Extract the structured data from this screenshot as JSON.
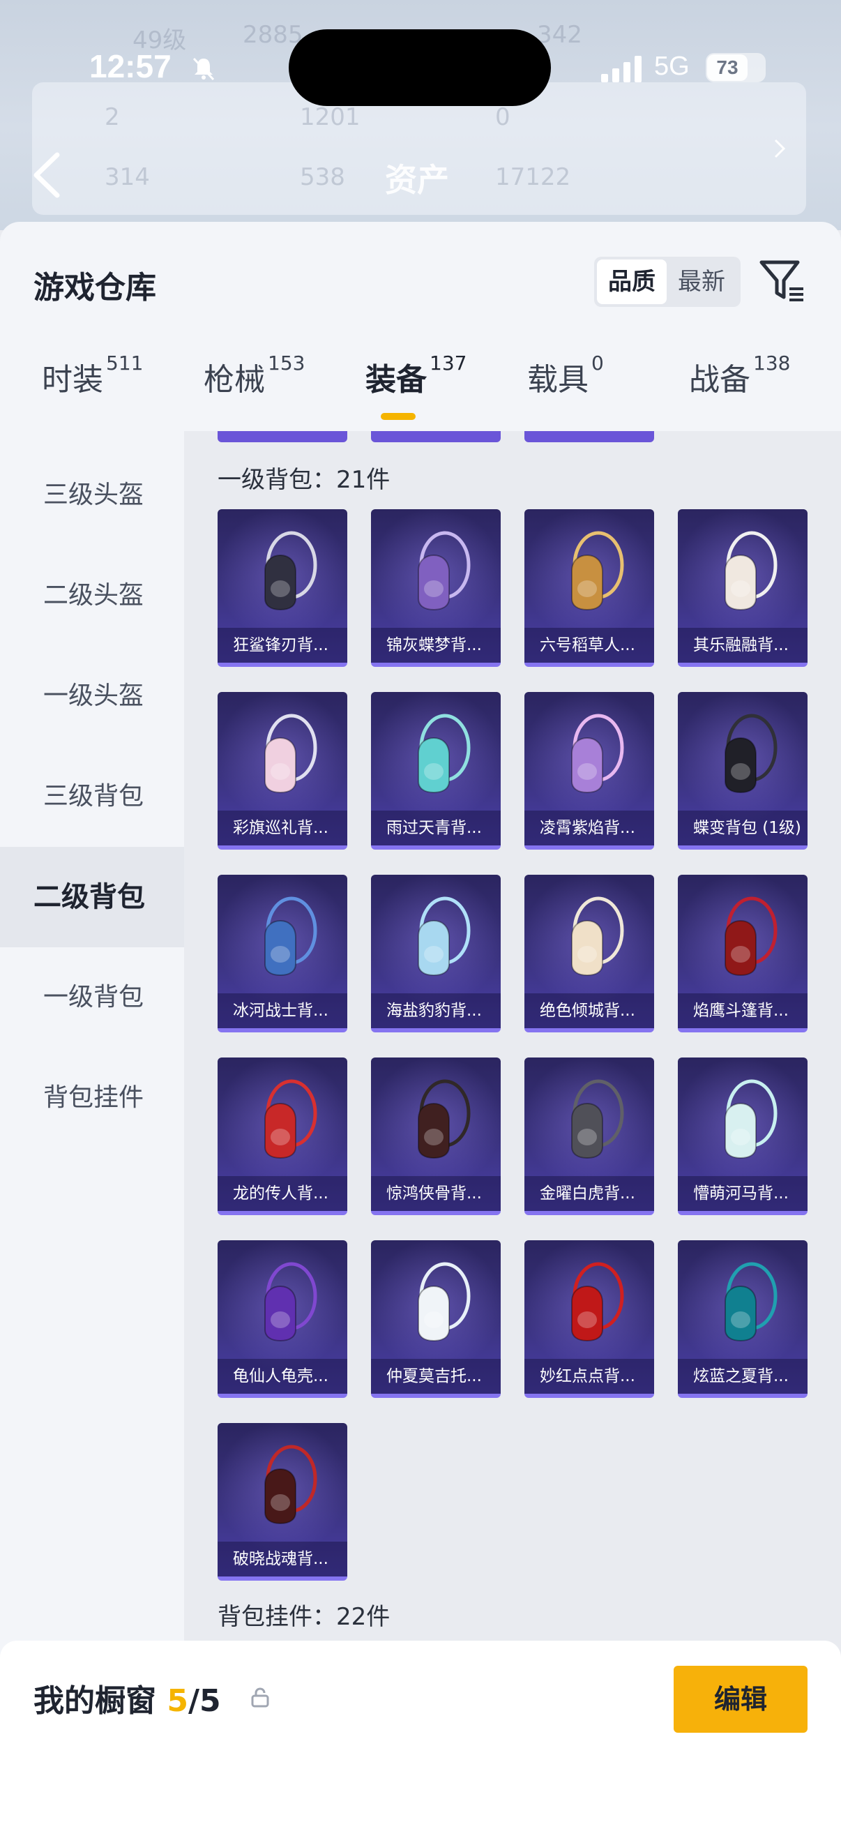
{
  "status_bar": {
    "time": "12:57",
    "network": "5G",
    "battery": "73"
  },
  "background": {
    "title": "资产",
    "ghost_level": "49级",
    "ghost_values": [
      "2885",
      "342",
      "2",
      "1201",
      "0",
      "314",
      "538",
      "17122"
    ]
  },
  "sheet": {
    "title": "游戏仓库",
    "sort_options": [
      "品质",
      "最新"
    ]
  },
  "tabs": [
    {
      "label": "时装",
      "count": "511"
    },
    {
      "label": "枪械",
      "count": "153"
    },
    {
      "label": "装备",
      "count": "137"
    },
    {
      "label": "载具",
      "count": "0"
    },
    {
      "label": "战备",
      "count": "138"
    }
  ],
  "sidebar": {
    "items": [
      "三级头盔",
      "二级头盔",
      "一级头盔",
      "三级背包",
      "二级背包",
      "一级背包",
      "背包挂件"
    ],
    "active": "二级背包"
  },
  "sections": [
    {
      "label": "一级背包：21件",
      "items": [
        "狂鲨锋刃背...",
        "锦灰蝶梦背...",
        "六号稻草人...",
        "其乐融融背...",
        "彩旗巡礼背...",
        "雨过天青背...",
        "凌霄紫焰背...",
        "蝶变背包 (1级)",
        "冰河战士背...",
        "海盐豹豹背...",
        "绝色倾城背...",
        "焰鹰斗篷背...",
        "龙的传人背...",
        "惊鸿侠骨背...",
        "金曜白虎背...",
        "懵萌河马背...",
        "龟仙人龟壳...",
        "仲夏莫吉托...",
        "妙红点点背...",
        "炫蓝之夏背...",
        "破晓战魂背..."
      ]
    },
    {
      "label": "背包挂件：22件"
    }
  ],
  "bottom_bar": {
    "title": "我的橱窗",
    "count_current": "5",
    "count_total": "/5",
    "edit_label": "编辑"
  },
  "colors": {
    "accent": "#f5b400",
    "card_top": "#2b2560",
    "card_bottom": "#4a3fa8"
  }
}
